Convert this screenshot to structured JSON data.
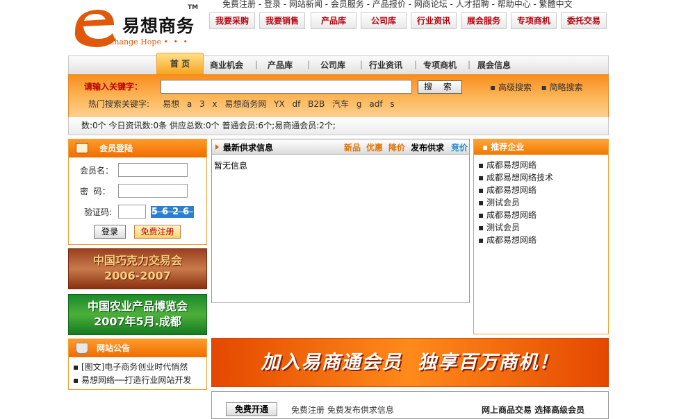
{
  "top_links": "免费注册 - 登录 - 网站新闻 - 会员服务 - 产品报价 - 网商论坛 - 人才招聘 - 帮助中心 - 繁體中文",
  "logo": {
    "cn": "易想商务",
    "en": "Change Hope",
    "tm": "TM"
  },
  "top_buttons": [
    "我要采购",
    "我要销售",
    "产品库",
    "公司库",
    "行业资讯",
    "展会服务",
    "专项商机",
    "委托交易"
  ],
  "main_nav": [
    "首 页",
    "商业机会",
    "产品库",
    "公司库",
    "行业资讯",
    "专项商机",
    "展会信息"
  ],
  "search": {
    "label": "请输入关键字：",
    "button": "搜 索",
    "advanced": "▪ 高级搜索",
    "simple": "▪ 简略搜索",
    "hot_label": "热门搜索关键字:",
    "hot_words": "易想 a 3 x 易想商务网 YX df B2B 汽车 g adf s"
  },
  "stats": "数:0个 今日资讯数:0条 供应总数:0个 普通会员:6个;易商通会员:2个;",
  "login": {
    "title": "会员登陆",
    "username_label": "会员名：",
    "password_label": "密  码：",
    "captcha_label": "验证码:",
    "captcha_text": "5626",
    "login_button": "登录",
    "register_button": "免费注册"
  },
  "banners": {
    "chocolate_line1": "中国巧克力交易会",
    "chocolate_line2": "2006-2007",
    "agri_line1": "中国农业产品博览会",
    "agri_line2": "2007年5月.成都"
  },
  "notice": {
    "title": "网站公告",
    "items": [
      "▪ [图文]电子商务创业时代悄然",
      "▪ 易想网络──打造行业网站开发"
    ]
  },
  "supply": {
    "title": "最新供求信息",
    "tags": [
      {
        "label": "新品",
        "color": "#e07000"
      },
      {
        "label": "优惠",
        "color": "#e07000"
      },
      {
        "label": "降价",
        "color": "#e07000"
      },
      {
        "label": "发布供求",
        "color": "#000000"
      },
      {
        "label": "竞价",
        "color": "#1a8ad0"
      }
    ],
    "empty": "暂无信息"
  },
  "recommend": {
    "title": "▪ 推荐企业",
    "items": [
      "▪ 成都易想网络",
      "▪ 成都易想网络技术",
      "▪ 成都易想网络",
      "▪ 测试会员",
      "▪ 成都易想网络",
      "▪ 测试会员",
      "▪ 成都易想网络"
    ]
  },
  "big_banner": "加入易商通会员  独享百万商机！",
  "bottom": {
    "open_button": "免费开通",
    "text": "免费注册 免费发布供求信息",
    "right_text": "网上商品交易 选择高级会员"
  },
  "colors": {
    "orange": "#f07800",
    "red": "#c00000",
    "blue": "#1a8ad0"
  }
}
